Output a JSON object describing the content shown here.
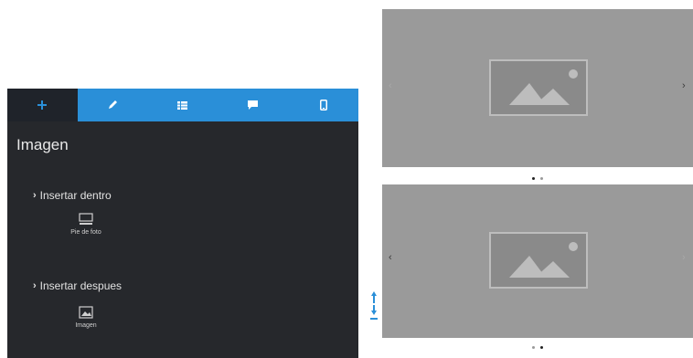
{
  "panel": {
    "title": "Imagen",
    "toolbar": [
      {
        "icon": "plus-icon",
        "active": true
      },
      {
        "icon": "pencil-icon",
        "active": false
      },
      {
        "icon": "grid-icon",
        "active": false
      },
      {
        "icon": "comment-icon",
        "active": false
      },
      {
        "icon": "mobile-icon",
        "active": false
      }
    ],
    "sections": [
      {
        "label": "Insertar dentro",
        "items": [
          {
            "label": "Pie de foto",
            "icon": "caption-icon"
          }
        ]
      },
      {
        "label": "Insertar despues",
        "items": [
          {
            "label": "Imagen",
            "icon": "image-icon"
          }
        ]
      }
    ]
  },
  "preview": {
    "carousels": [
      {
        "dots": 2,
        "active_dot": 1
      },
      {
        "dots": 2,
        "active_dot": 2
      }
    ]
  },
  "colors": {
    "accent": "#2a8fd8",
    "panel_bg": "#26282c",
    "slide_bg": "#9a9a9a"
  }
}
